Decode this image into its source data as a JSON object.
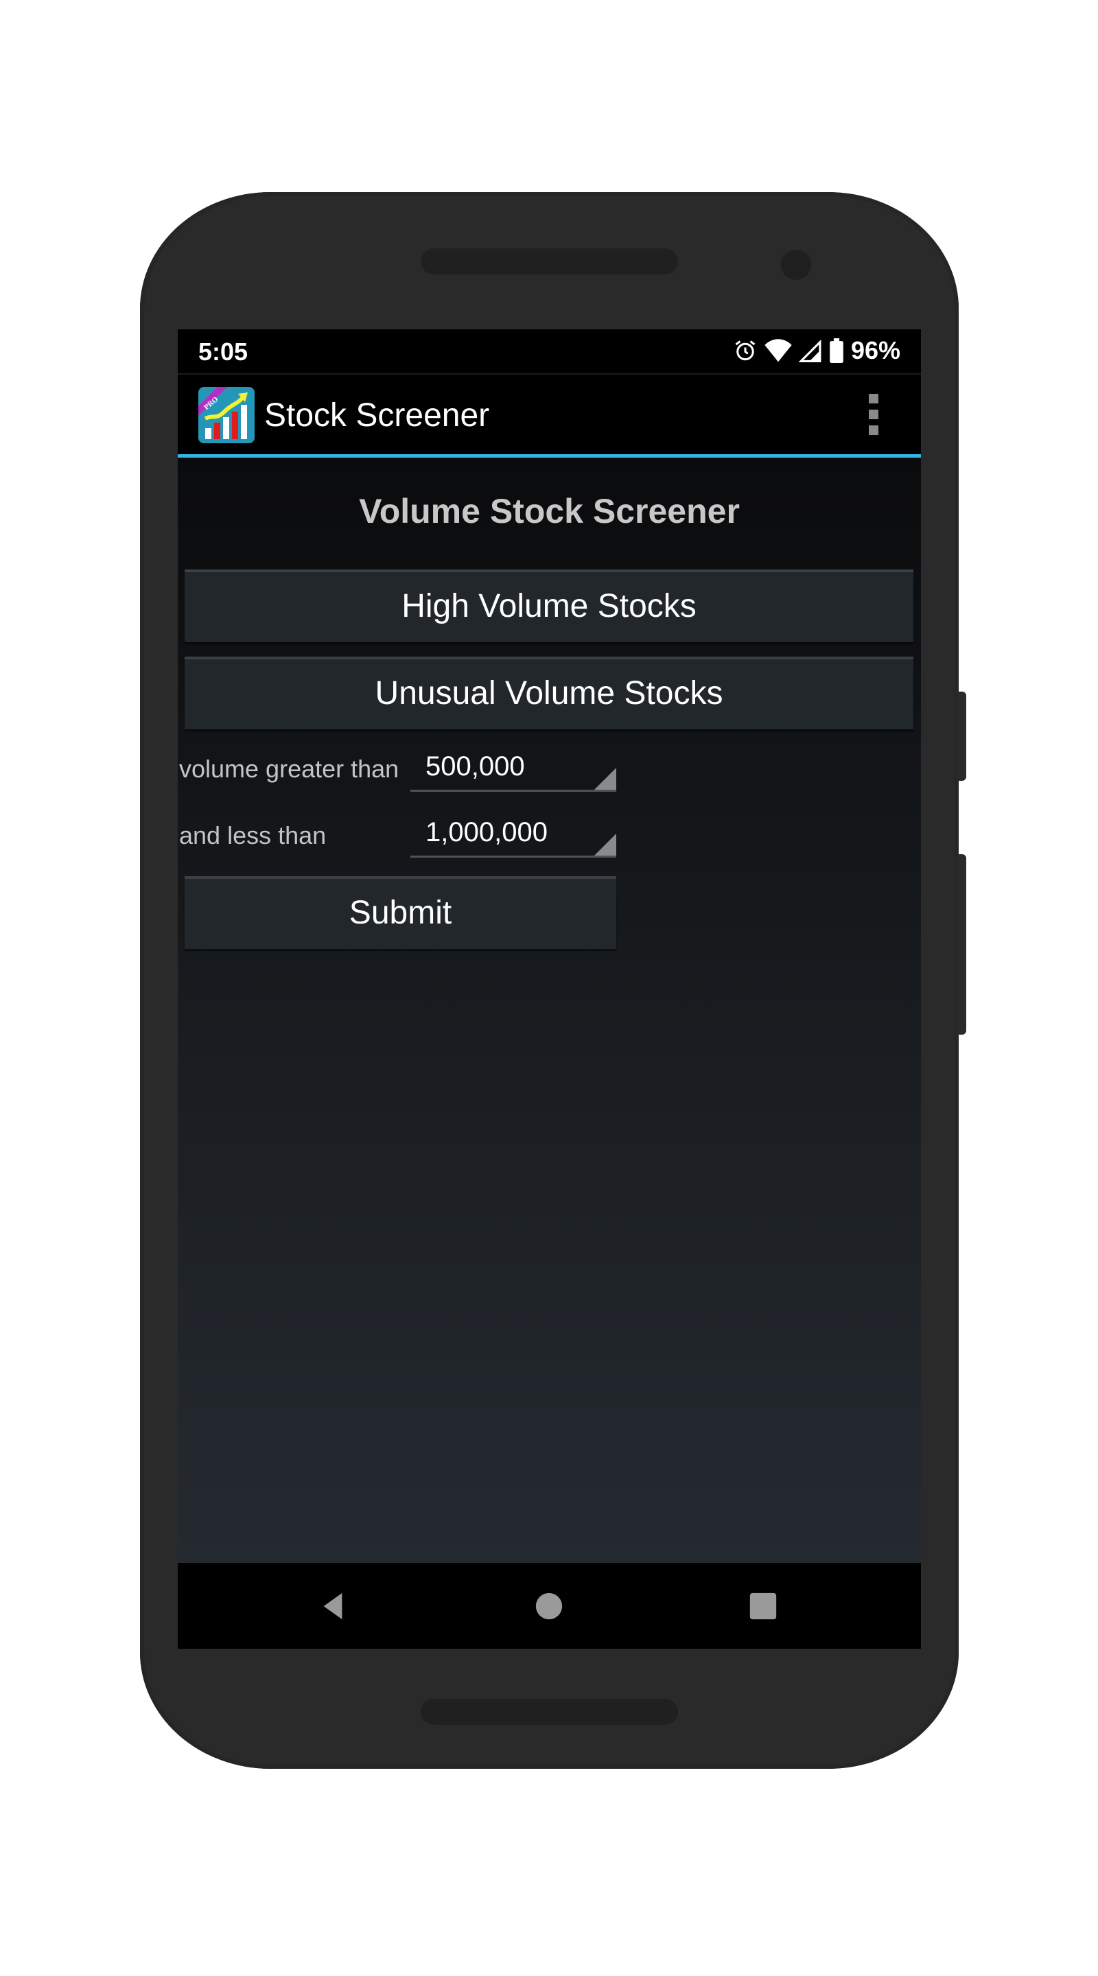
{
  "status_bar": {
    "time": "5:05",
    "battery_percent": "96%",
    "icons": [
      "alarm-icon",
      "wifi-icon",
      "cell-signal-icon",
      "battery-icon"
    ]
  },
  "app_bar": {
    "title": "Stock Screener",
    "icon_badge": "PRO",
    "menu_icon": "overflow-menu-icon",
    "accent_color": "#33b5e5"
  },
  "main": {
    "heading": "Volume Stock Screener",
    "buttons": [
      {
        "label": "High Volume Stocks"
      },
      {
        "label": "Unusual Volume Stocks"
      }
    ],
    "filters": [
      {
        "label": "volume greater than",
        "value": "500,000"
      },
      {
        "label": "and less than",
        "value": "1,000,000"
      }
    ],
    "submit_label": "Submit"
  },
  "nav_bar": {
    "items": [
      "back-icon",
      "home-icon",
      "recents-icon"
    ]
  }
}
